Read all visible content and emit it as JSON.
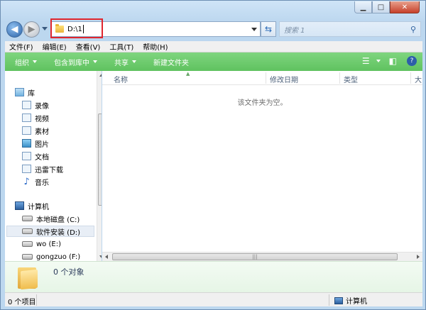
{
  "address": {
    "path": "D:\\1"
  },
  "search": {
    "placeholder": "搜索 1"
  },
  "menu": [
    "文件(F)",
    "编辑(E)",
    "查看(V)",
    "工具(T)",
    "帮助(H)"
  ],
  "commands": [
    {
      "label": "组织",
      "dropdown": true
    },
    {
      "label": "包含到库中",
      "dropdown": true
    },
    {
      "label": "共享",
      "dropdown": true
    },
    {
      "label": "新建文件夹",
      "dropdown": false
    }
  ],
  "navigation": {
    "library_title": "库",
    "libraries": [
      {
        "label": "录像",
        "icon": "video-library-icon"
      },
      {
        "label": "视频",
        "icon": "video-library-icon"
      },
      {
        "label": "素材",
        "icon": "library-icon"
      },
      {
        "label": "图片",
        "icon": "picture-library-icon"
      },
      {
        "label": "文档",
        "icon": "document-library-icon"
      },
      {
        "label": "迅雷下载",
        "icon": "library-icon"
      },
      {
        "label": "音乐",
        "icon": "music-library-icon"
      }
    ],
    "computer_title": "计算机",
    "drives": [
      {
        "label": "本地磁盘 (C:)",
        "selected": false
      },
      {
        "label": "软件安装 (D:)",
        "selected": true
      },
      {
        "label": "wo (E:)",
        "selected": false
      },
      {
        "label": "gongzuo (F:)",
        "selected": false
      }
    ]
  },
  "columns": [
    "名称",
    "修改日期",
    "类型",
    "大"
  ],
  "content": {
    "empty_message": "该文件夹为空。"
  },
  "details": {
    "count": "0 个对象"
  },
  "status": {
    "items": "0 个项目",
    "location": "计算机"
  },
  "colors": {
    "command_bar": "#5fc25f",
    "highlight": "#e0262e"
  }
}
